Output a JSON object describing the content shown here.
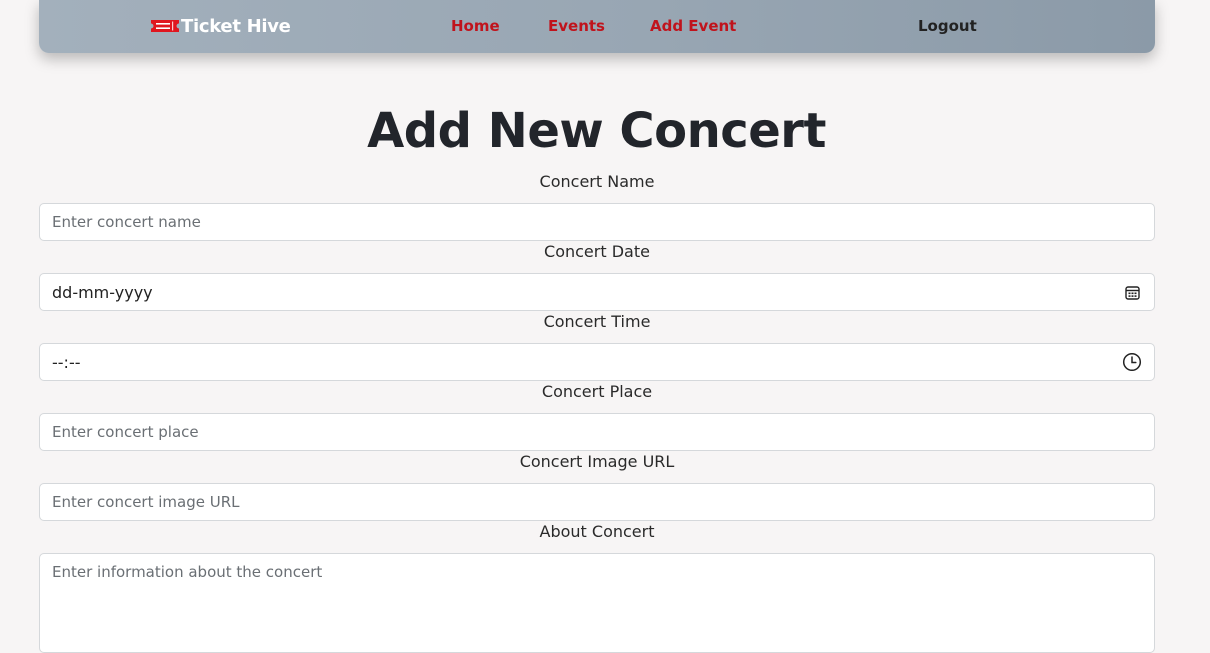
{
  "navbar": {
    "brand": "Ticket Hive",
    "brand_icon": "ticket-icon",
    "links": {
      "home": "Home",
      "events": "Events",
      "add_event": "Add Event"
    },
    "logout": "Logout",
    "colors": {
      "link": "#c0131c",
      "brand_text": "#ffffff",
      "logout": "#222222"
    }
  },
  "page": {
    "title": "Add New Concert"
  },
  "form": {
    "name": {
      "label": "Concert Name",
      "placeholder": "Enter concert name"
    },
    "date": {
      "label": "Concert Date",
      "value": "dd-mm-yyyy",
      "icon": "calendar-icon"
    },
    "time": {
      "label": "Concert Time",
      "value": "--:--",
      "icon": "clock-icon"
    },
    "place": {
      "label": "Concert Place",
      "placeholder": "Enter concert place"
    },
    "image_url": {
      "label": "Concert Image URL",
      "placeholder": "Enter concert image URL"
    },
    "about": {
      "label": "About Concert",
      "placeholder": "Enter information about the concert"
    }
  }
}
